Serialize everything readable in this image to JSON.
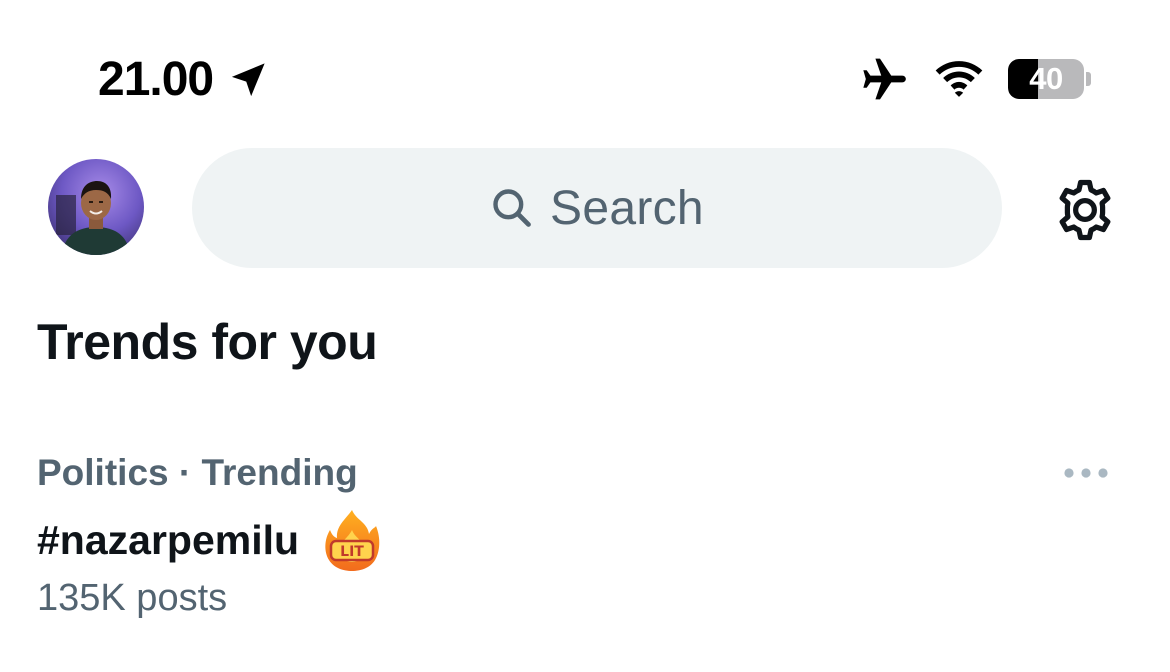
{
  "status_bar": {
    "time": "21.00",
    "location_icon": "location-arrow-icon",
    "airplane_icon": "airplane-mode-icon",
    "wifi_icon": "wifi-icon",
    "battery_level": "40",
    "battery_fraction": 0.4
  },
  "header": {
    "avatar_icon": "profile-avatar",
    "search": {
      "placeholder": "Search",
      "icon": "search-icon"
    },
    "settings_icon": "gear-icon"
  },
  "section": {
    "title": "Trends for you"
  },
  "trends": [
    {
      "meta": "Politics · Trending",
      "title": "#nazarpemilu",
      "emoji": "fire-lit-icon",
      "count": "135K posts",
      "more_icon": "more-horizontal-icon"
    }
  ],
  "colors": {
    "text_primary": "#0f1419",
    "text_secondary": "#536471",
    "search_bg": "#eff3f4",
    "background": "#ffffff"
  }
}
